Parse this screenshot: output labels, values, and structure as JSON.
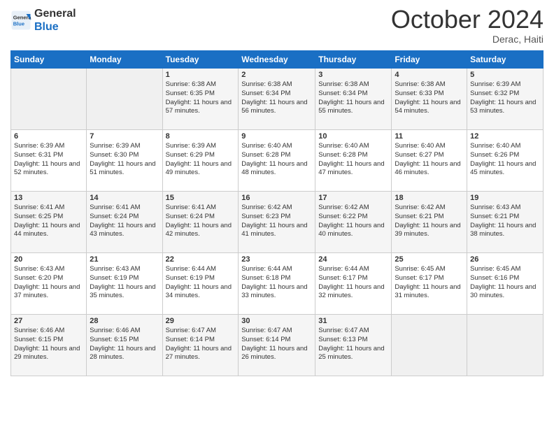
{
  "logo": {
    "line1": "General",
    "line2": "Blue"
  },
  "title": "October 2024",
  "location": "Derac, Haiti",
  "weekdays": [
    "Sunday",
    "Monday",
    "Tuesday",
    "Wednesday",
    "Thursday",
    "Friday",
    "Saturday"
  ],
  "weeks": [
    [
      {
        "day": "",
        "info": ""
      },
      {
        "day": "",
        "info": ""
      },
      {
        "day": "1",
        "info": "Sunrise: 6:38 AM\nSunset: 6:35 PM\nDaylight: 11 hours and 57 minutes."
      },
      {
        "day": "2",
        "info": "Sunrise: 6:38 AM\nSunset: 6:34 PM\nDaylight: 11 hours and 56 minutes."
      },
      {
        "day": "3",
        "info": "Sunrise: 6:38 AM\nSunset: 6:34 PM\nDaylight: 11 hours and 55 minutes."
      },
      {
        "day": "4",
        "info": "Sunrise: 6:38 AM\nSunset: 6:33 PM\nDaylight: 11 hours and 54 minutes."
      },
      {
        "day": "5",
        "info": "Sunrise: 6:39 AM\nSunset: 6:32 PM\nDaylight: 11 hours and 53 minutes."
      }
    ],
    [
      {
        "day": "6",
        "info": "Sunrise: 6:39 AM\nSunset: 6:31 PM\nDaylight: 11 hours and 52 minutes."
      },
      {
        "day": "7",
        "info": "Sunrise: 6:39 AM\nSunset: 6:30 PM\nDaylight: 11 hours and 51 minutes."
      },
      {
        "day": "8",
        "info": "Sunrise: 6:39 AM\nSunset: 6:29 PM\nDaylight: 11 hours and 49 minutes."
      },
      {
        "day": "9",
        "info": "Sunrise: 6:40 AM\nSunset: 6:28 PM\nDaylight: 11 hours and 48 minutes."
      },
      {
        "day": "10",
        "info": "Sunrise: 6:40 AM\nSunset: 6:28 PM\nDaylight: 11 hours and 47 minutes."
      },
      {
        "day": "11",
        "info": "Sunrise: 6:40 AM\nSunset: 6:27 PM\nDaylight: 11 hours and 46 minutes."
      },
      {
        "day": "12",
        "info": "Sunrise: 6:40 AM\nSunset: 6:26 PM\nDaylight: 11 hours and 45 minutes."
      }
    ],
    [
      {
        "day": "13",
        "info": "Sunrise: 6:41 AM\nSunset: 6:25 PM\nDaylight: 11 hours and 44 minutes."
      },
      {
        "day": "14",
        "info": "Sunrise: 6:41 AM\nSunset: 6:24 PM\nDaylight: 11 hours and 43 minutes."
      },
      {
        "day": "15",
        "info": "Sunrise: 6:41 AM\nSunset: 6:24 PM\nDaylight: 11 hours and 42 minutes."
      },
      {
        "day": "16",
        "info": "Sunrise: 6:42 AM\nSunset: 6:23 PM\nDaylight: 11 hours and 41 minutes."
      },
      {
        "day": "17",
        "info": "Sunrise: 6:42 AM\nSunset: 6:22 PM\nDaylight: 11 hours and 40 minutes."
      },
      {
        "day": "18",
        "info": "Sunrise: 6:42 AM\nSunset: 6:21 PM\nDaylight: 11 hours and 39 minutes."
      },
      {
        "day": "19",
        "info": "Sunrise: 6:43 AM\nSunset: 6:21 PM\nDaylight: 11 hours and 38 minutes."
      }
    ],
    [
      {
        "day": "20",
        "info": "Sunrise: 6:43 AM\nSunset: 6:20 PM\nDaylight: 11 hours and 37 minutes."
      },
      {
        "day": "21",
        "info": "Sunrise: 6:43 AM\nSunset: 6:19 PM\nDaylight: 11 hours and 35 minutes."
      },
      {
        "day": "22",
        "info": "Sunrise: 6:44 AM\nSunset: 6:19 PM\nDaylight: 11 hours and 34 minutes."
      },
      {
        "day": "23",
        "info": "Sunrise: 6:44 AM\nSunset: 6:18 PM\nDaylight: 11 hours and 33 minutes."
      },
      {
        "day": "24",
        "info": "Sunrise: 6:44 AM\nSunset: 6:17 PM\nDaylight: 11 hours and 32 minutes."
      },
      {
        "day": "25",
        "info": "Sunrise: 6:45 AM\nSunset: 6:17 PM\nDaylight: 11 hours and 31 minutes."
      },
      {
        "day": "26",
        "info": "Sunrise: 6:45 AM\nSunset: 6:16 PM\nDaylight: 11 hours and 30 minutes."
      }
    ],
    [
      {
        "day": "27",
        "info": "Sunrise: 6:46 AM\nSunset: 6:15 PM\nDaylight: 11 hours and 29 minutes."
      },
      {
        "day": "28",
        "info": "Sunrise: 6:46 AM\nSunset: 6:15 PM\nDaylight: 11 hours and 28 minutes."
      },
      {
        "day": "29",
        "info": "Sunrise: 6:47 AM\nSunset: 6:14 PM\nDaylight: 11 hours and 27 minutes."
      },
      {
        "day": "30",
        "info": "Sunrise: 6:47 AM\nSunset: 6:14 PM\nDaylight: 11 hours and 26 minutes."
      },
      {
        "day": "31",
        "info": "Sunrise: 6:47 AM\nSunset: 6:13 PM\nDaylight: 11 hours and 25 minutes."
      },
      {
        "day": "",
        "info": ""
      },
      {
        "day": "",
        "info": ""
      }
    ]
  ]
}
